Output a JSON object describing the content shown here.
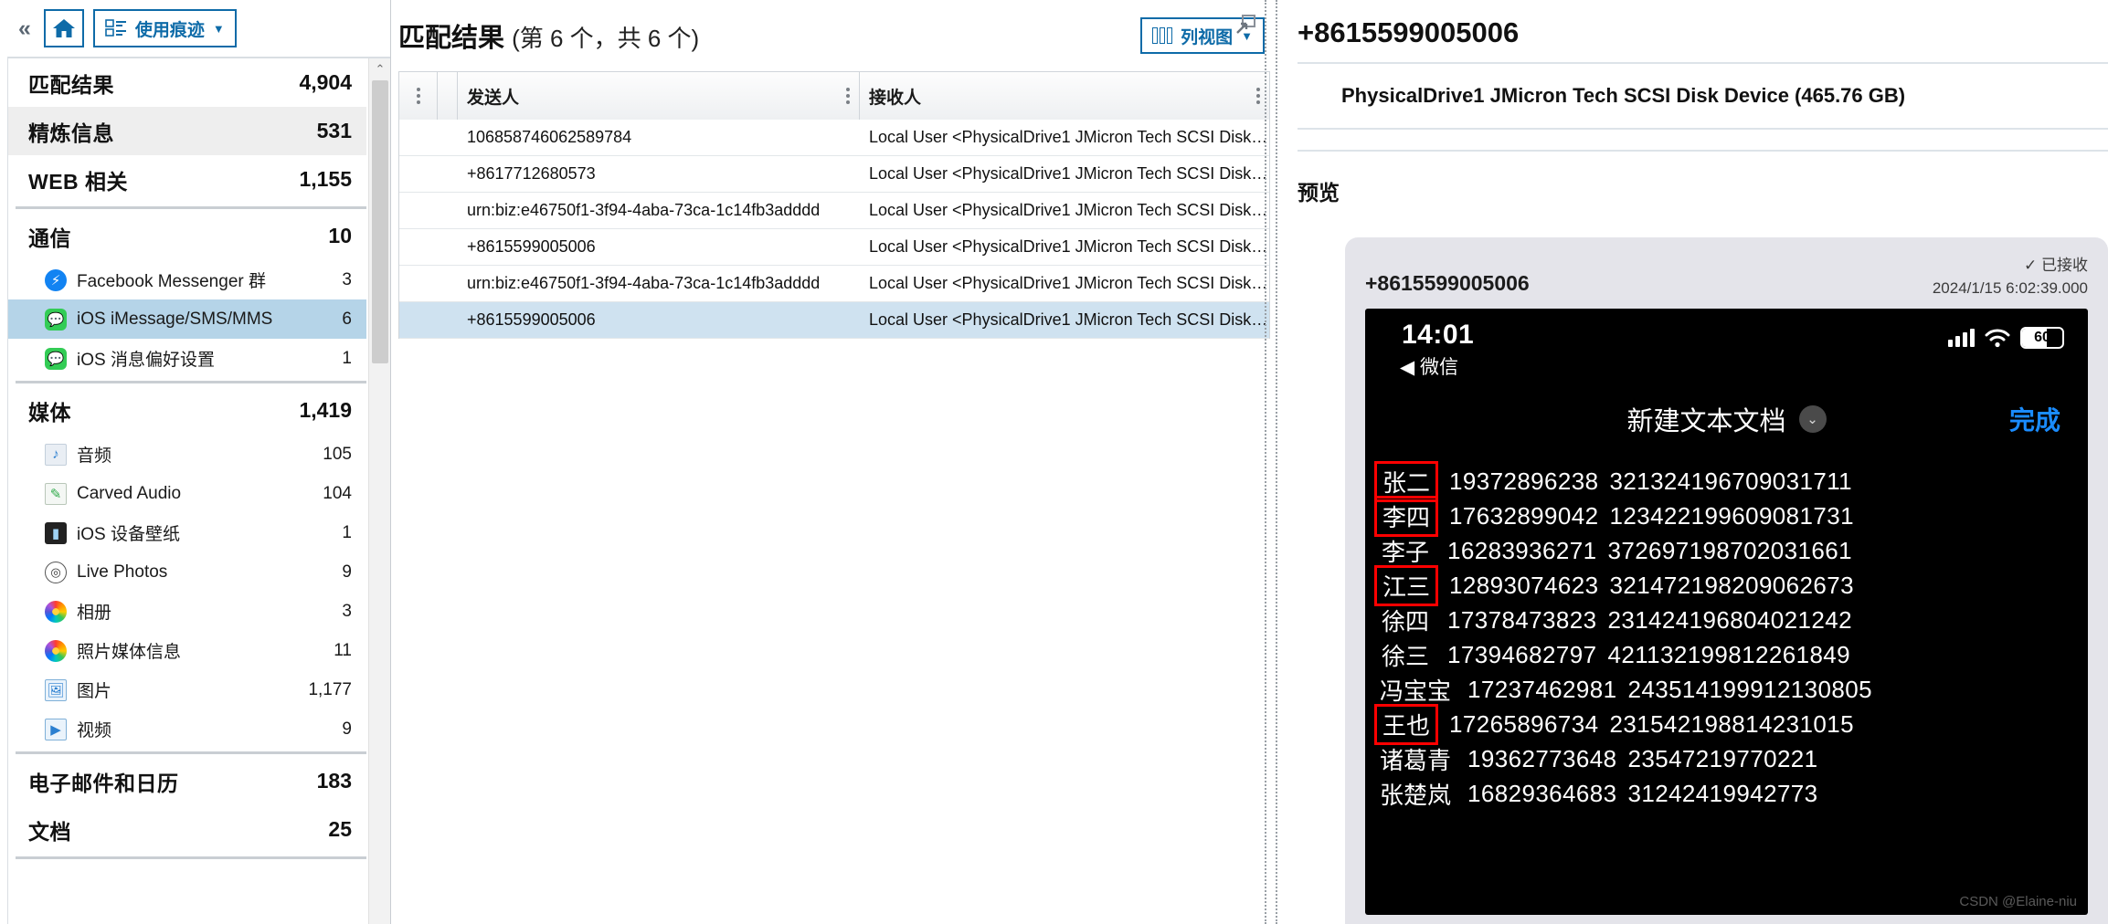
{
  "sidebar": {
    "collapse_label": "«",
    "home_icon": "home-icon",
    "trace_button": {
      "label": "使用痕迹",
      "caret": "▼"
    },
    "groups": [
      {
        "label": "匹配结果",
        "count": "4,904",
        "style": "plain"
      },
      {
        "label": "精炼信息",
        "count": "531",
        "style": "shaded"
      },
      {
        "label": "WEB 相关",
        "count": "1,155",
        "style": "plain"
      }
    ],
    "comm_group": {
      "label": "通信",
      "count": "10"
    },
    "comm_items": [
      {
        "label": "Facebook Messenger 群",
        "count": "3",
        "icon": "messenger-icon",
        "selected": false
      },
      {
        "label": "iOS iMessage/SMS/MMS",
        "count": "6",
        "icon": "ios-messages-icon",
        "selected": true
      },
      {
        "label": "iOS 消息偏好设置",
        "count": "1",
        "icon": "ios-messages-icon",
        "selected": false
      }
    ],
    "media_group": {
      "label": "媒体",
      "count": "1,419"
    },
    "media_items": [
      {
        "label": "音频",
        "count": "105",
        "icon": "audio-note-icon"
      },
      {
        "label": "Carved Audio",
        "count": "104",
        "icon": "carved-audio-icon"
      },
      {
        "label": "iOS 设备壁纸",
        "count": "1",
        "icon": "wallpaper-icon"
      },
      {
        "label": "Live Photos",
        "count": "9",
        "icon": "live-photos-icon"
      },
      {
        "label": "相册",
        "count": "3",
        "icon": "photos-app-icon"
      },
      {
        "label": "照片媒体信息",
        "count": "11",
        "icon": "photos-app-icon"
      },
      {
        "label": "图片",
        "count": "1,177",
        "icon": "picture-icon"
      },
      {
        "label": "视频",
        "count": "9",
        "icon": "video-icon"
      }
    ],
    "tail_groups": [
      {
        "label": "电子邮件和日历",
        "count": "183"
      },
      {
        "label": "文档",
        "count": "25"
      }
    ]
  },
  "middle": {
    "title_main": "匹配结果",
    "title_sub": "(第 6 个，共 6 个)",
    "column_view_button": "列视图",
    "column_view_caret": "▼",
    "pin_icon": "pin-expand-icon",
    "columns": [
      "发送人",
      "接收人"
    ],
    "rows": [
      {
        "sender": "106858746062589784",
        "receiver": "Local User <PhysicalDrive1 JMicron Tech SCSI Disk…",
        "selected": false
      },
      {
        "sender": "+8617712680573",
        "receiver": "Local User <PhysicalDrive1 JMicron Tech SCSI Disk…",
        "selected": false
      },
      {
        "sender": "urn:biz:e46750f1-3f94-4aba-73ca-1c14fb3adddd",
        "receiver": "Local User <PhysicalDrive1 JMicron Tech SCSI Disk…",
        "selected": false
      },
      {
        "sender": "+8615599005006",
        "receiver": "Local User <PhysicalDrive1 JMicron Tech SCSI Disk…",
        "selected": false
      },
      {
        "sender": "urn:biz:e46750f1-3f94-4aba-73ca-1c14fb3adddd",
        "receiver": "Local User <PhysicalDrive1 JMicron Tech SCSI Disk…",
        "selected": false
      },
      {
        "sender": "+8615599005006",
        "receiver": "Local User <PhysicalDrive1 JMicron Tech SCSI Disk…",
        "selected": true
      }
    ]
  },
  "right": {
    "title": "+8615599005006",
    "device_card": "PhysicalDrive1 JMicron Tech SCSI Disk Device (465.76 GB)",
    "preview_label": "预览",
    "message": {
      "phone": "+8615599005006",
      "status": "✓ 已接收",
      "timestamp": "2024/1/15 6:02:39.000"
    },
    "phone_screenshot": {
      "status_time": "14:01",
      "battery_percent": "60",
      "back_label": "◀ 微信",
      "doc_title": "新建文本文档",
      "chevron": "⌄",
      "done_label": "完成",
      "contacts": [
        {
          "name": "张二",
          "phone": "19372896238",
          "id": "321324196709031711",
          "highlighted": true
        },
        {
          "name": "李四",
          "phone": "17632899042",
          "id": "123422199609081731",
          "highlighted": true
        },
        {
          "name": "李子",
          "phone": "16283936271",
          "id": "372697198702031661",
          "highlighted": false
        },
        {
          "name": "江三",
          "phone": "12893074623",
          "id": "321472198209062673",
          "highlighted": true
        },
        {
          "name": "徐四",
          "phone": "17378473823",
          "id": "231424196804021242",
          "highlighted": false
        },
        {
          "name": "徐三",
          "phone": "17394682797",
          "id": "421132199812261849",
          "highlighted": false
        },
        {
          "name": "冯宝宝",
          "phone": "17237462981",
          "id": "243514199912130805",
          "highlighted": false
        },
        {
          "name": "王也",
          "phone": "17265896734",
          "id": "231542198814231015",
          "highlighted": true
        },
        {
          "name": "诸葛青",
          "phone": "19362773648",
          "id": "23547219770221",
          "highlighted": false
        },
        {
          "name": "张楚岚",
          "phone": "16829364683",
          "id": "31242419942773",
          "highlighted": false
        }
      ],
      "watermark": "CSDN @Elaine-niu"
    }
  }
}
